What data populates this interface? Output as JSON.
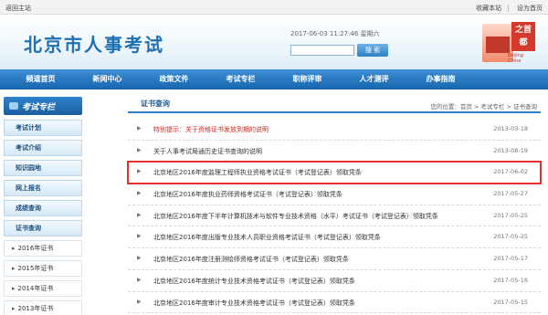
{
  "topbar": {
    "home_link": "返回主站",
    "bookmark_link": "收藏本站",
    "separator": "|",
    "set_home_link": "设为首页"
  },
  "banner": {
    "logo_text": "北京市人事考试",
    "datetime": "2017-06-03 11:27:46 星期六",
    "search_button": "搜 索",
    "emblem_text": "之首 都",
    "emblem_sub": "Beijing China"
  },
  "nav": {
    "items": [
      "频道首页",
      "新闻中心",
      "政策文件",
      "考试专栏",
      "职称评审",
      "人才测评",
      "办事指南"
    ]
  },
  "sidebar": {
    "title": "考试专栏",
    "menu": [
      "考试计划",
      "考试介绍",
      "知识园地",
      "网上报名",
      "成绩查询",
      "证书查询"
    ],
    "submenu": [
      "2016年证书",
      "2015年证书",
      "2014年证书",
      "2013年证书"
    ]
  },
  "main": {
    "tab": "证书查询",
    "breadcrumb": "您的位置：首页 > 考试专栏 > 证书查询",
    "rows": [
      {
        "title": "特别提示：关于资格证书发放到期的说明",
        "date": "2013-03-18",
        "style": "red"
      },
      {
        "title": "关于人事考试局通历史证书查询的说明",
        "date": "2013-08-19",
        "style": "normal"
      },
      {
        "title": "北京地区2016年度监理工程师执业资格考试证书（考试登记表）领取凭条",
        "date": "2017-06-02",
        "style": "highlight"
      },
      {
        "title": "北京地区2016年度执业药师资格考试证书（考试登记表）领取凭条",
        "date": "2017-05-27",
        "style": "normal"
      },
      {
        "title": "北京地区2016年度下半年计算机技术与软件专业技术资格（水平）考试证书（考试登记表）领取凭条",
        "date": "2017-05-25",
        "style": "normal"
      },
      {
        "title": "北京地区2016年度出版专业技术人员职业资格考试证书（考试登记表）领取凭条",
        "date": "2017-05-25",
        "style": "normal"
      },
      {
        "title": "北京地区2016年度注册测绘师资格考试证书（考试登记表）领取凭条",
        "date": "2017-05-17",
        "style": "normal"
      },
      {
        "title": "北京地区2016年度统计专业技术资格考试证书（考试登记表）领取凭条",
        "date": "2017-05-16",
        "style": "normal"
      },
      {
        "title": "北京地区2016年度审计专业技术资格考试证书（考试登记表）领取凭条",
        "date": "2017-05-15",
        "style": "normal"
      }
    ]
  }
}
